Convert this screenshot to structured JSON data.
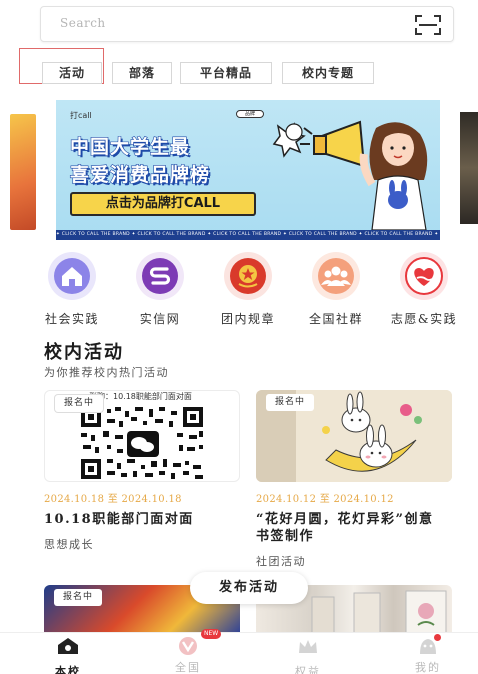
{
  "search": {
    "placeholder": "Search",
    "scan_icon": "scan-icon"
  },
  "tabs": [
    {
      "label": "活动",
      "active": true
    },
    {
      "label": "部落"
    },
    {
      "label": "平台精品"
    },
    {
      "label": "校内专题"
    }
  ],
  "banner": {
    "top_text": "打call",
    "pill_text": "品牌",
    "line1": "中国大学生最",
    "line2": "喜爱消费品牌榜",
    "button": "点击为品牌打CALL",
    "strip": "✦ CLICK TO CALL THE BRAND ✦ CLICK TO CALL THE BRAND ✦ CLICK TO CALL THE BRAND ✦ CLICK TO CALL THE BRAND ✦ CLICK TO CALL THE BRAND ✦"
  },
  "shortcuts": [
    {
      "label": "社会实践",
      "icon": "house-icon",
      "color": "#8c84e8"
    },
    {
      "label": "实信网",
      "icon": "s-logo-icon",
      "color": "#7d3bb5"
    },
    {
      "label": "团内规章",
      "icon": "youth-league-badge-icon",
      "color": "#d93a2b"
    },
    {
      "label": "全国社群",
      "icon": "community-icon",
      "color": "#f4a07c"
    },
    {
      "label": "志愿&实践",
      "icon": "heart-hand-icon",
      "color": "#e8383d"
    }
  ],
  "section": {
    "title": "校内活动",
    "subtitle": "为你推荐校内热门活动"
  },
  "cards": [
    {
      "badge": "报名中",
      "qr_caption": "群聊：10.18职能部门面对面",
      "date": "2024.10.18 至 2024.10.18",
      "title": "10.18职能部门面对面",
      "tag": "思想成长"
    },
    {
      "badge": "报名中",
      "date": "2024.10.12 至 2024.10.12",
      "title": "“花好月圆，花灯异彩”创意书签制作",
      "tag": "社团活动"
    }
  ],
  "lower_cards": [
    {
      "badge": "报名中"
    },
    {
      "badge": ""
    }
  ],
  "publish_button": "发布活动",
  "nav": [
    {
      "label": "本校",
      "icon": "home-icon",
      "active": true
    },
    {
      "label": "全国",
      "icon": "v-logo-icon",
      "badge": "NEW"
    },
    {
      "label": "权益",
      "icon": "crown-icon"
    },
    {
      "label": "我的",
      "icon": "profile-icon",
      "dot": true
    }
  ],
  "colors": {
    "accent_date": "#e6a948",
    "banner_blue": "#1e4aa8",
    "banner_yellow": "#f7d44a",
    "badge_red": "#e8383d"
  }
}
